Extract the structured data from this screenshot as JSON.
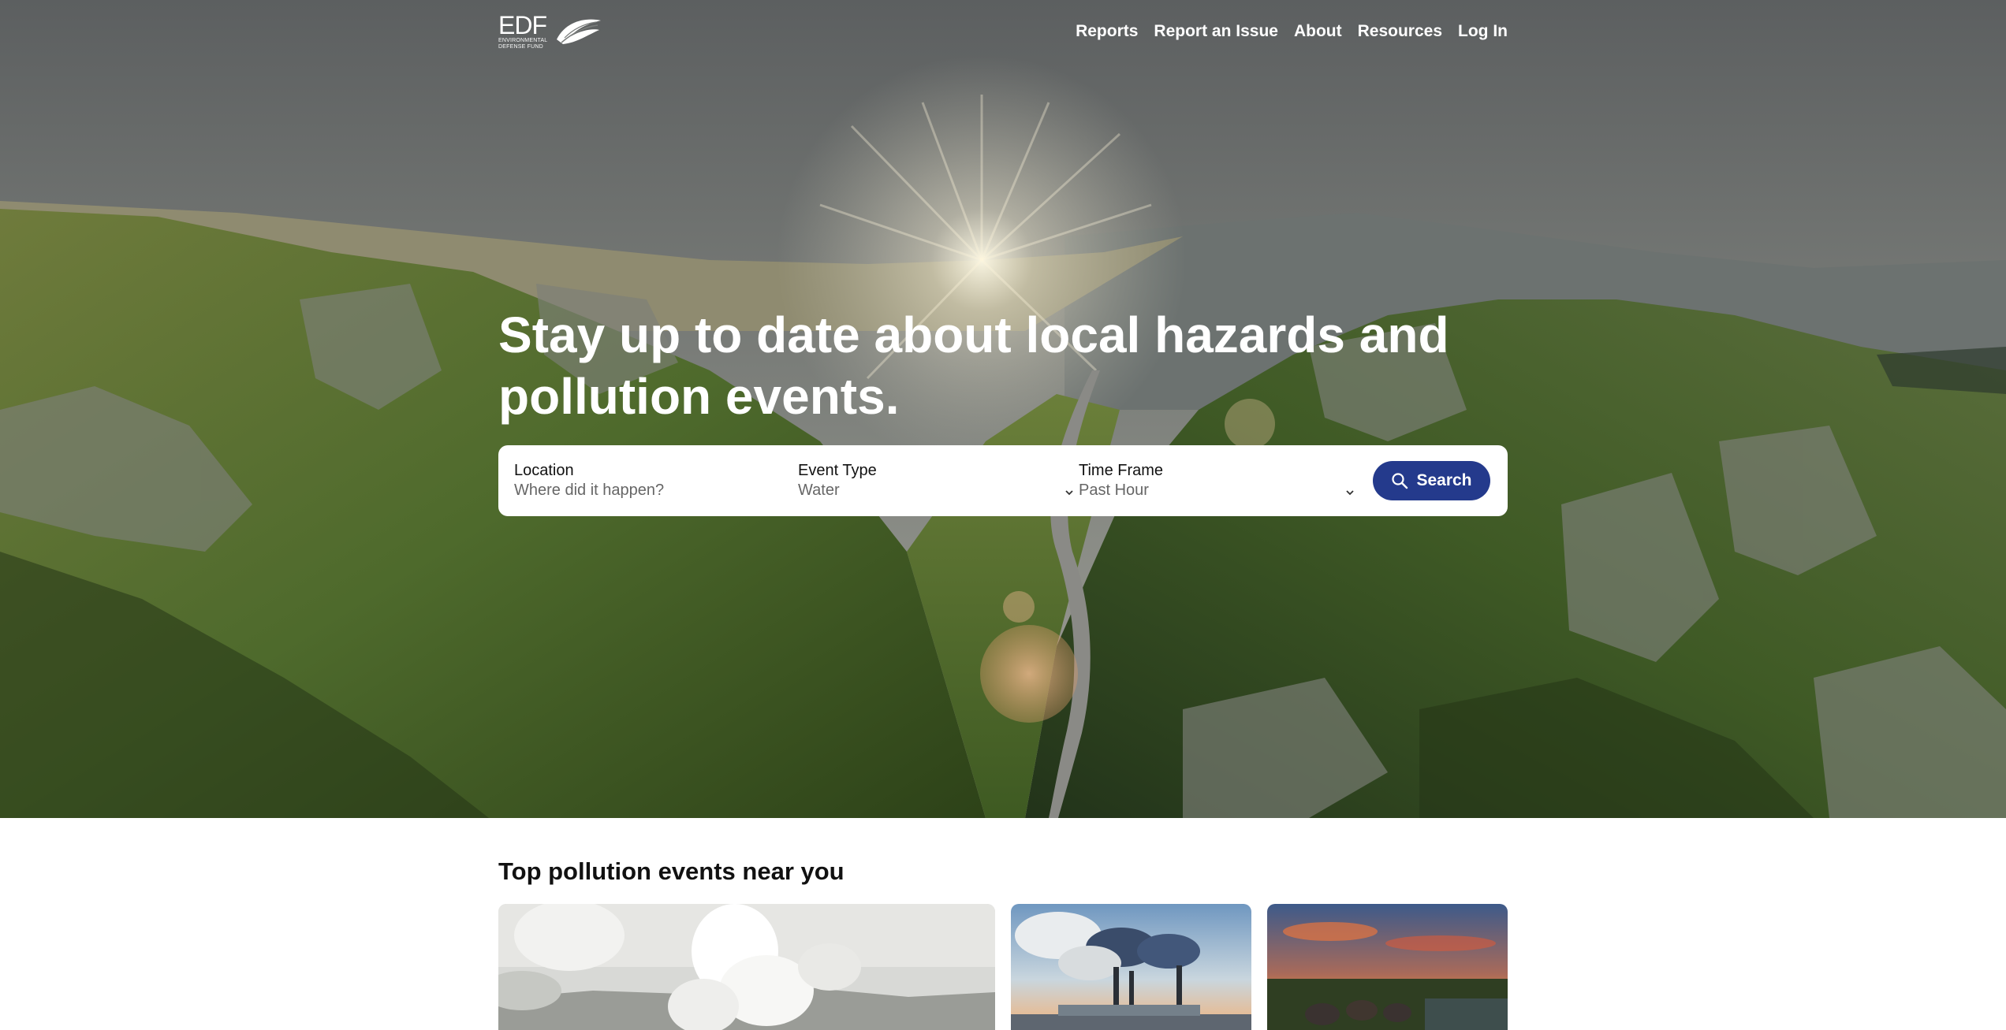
{
  "brand": {
    "logo_mark": "EDF",
    "logo_subtext": "ENVIRONMENTAL DEFENSE FUND"
  },
  "nav": {
    "items": [
      {
        "label": "Reports"
      },
      {
        "label": "Report an Issue"
      },
      {
        "label": "About"
      },
      {
        "label": "Resources"
      },
      {
        "label": "Log In"
      }
    ]
  },
  "hero": {
    "headline": "Stay up to date about local hazards and pollution events."
  },
  "search": {
    "location": {
      "label": "Location",
      "placeholder": "Where did it happen?"
    },
    "event_type": {
      "label": "Event Type",
      "value": "Water"
    },
    "time_frame": {
      "label": "Time Frame",
      "value": "Past Hour"
    },
    "button_label": "Search"
  },
  "events_section": {
    "title": "Top pollution events near you"
  },
  "colors": {
    "accent": "#243a8c",
    "nav_text": "#ffffff"
  },
  "icons": [
    "edf-leaf-icon",
    "chevron-down-icon",
    "search-icon"
  ]
}
